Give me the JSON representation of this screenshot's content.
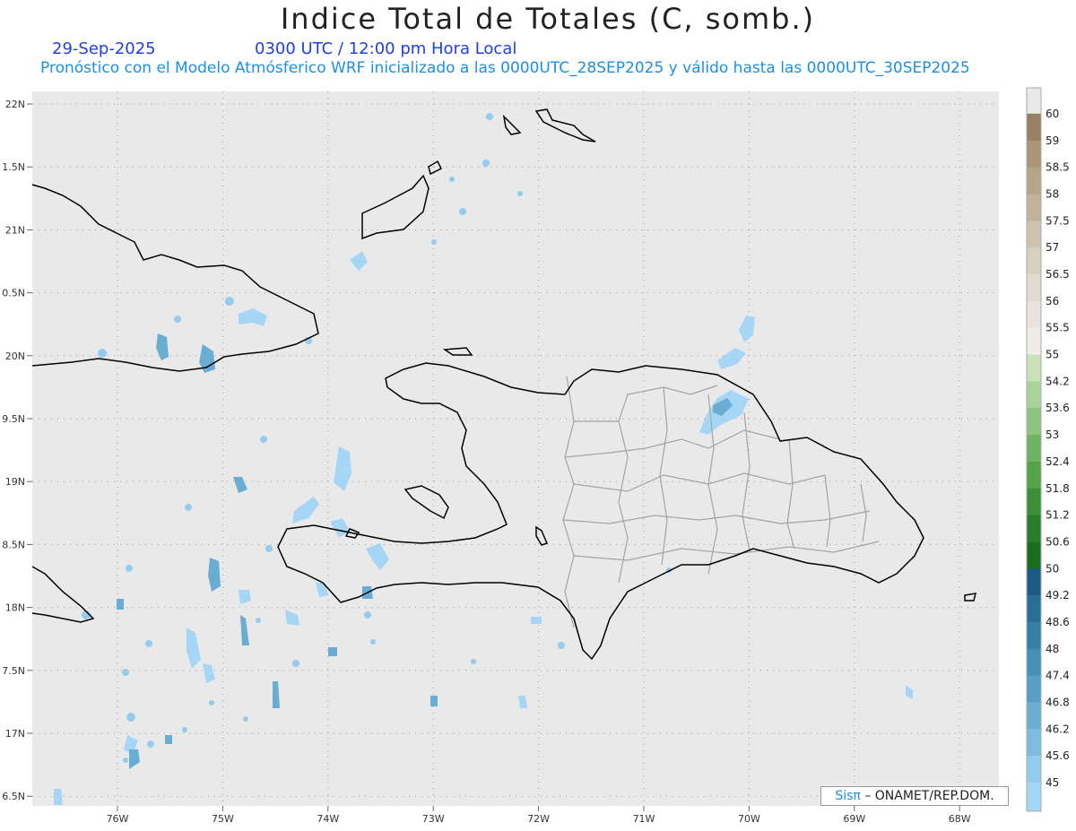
{
  "header": {
    "title": "Indice Total de Totales (C, somb.)",
    "date": "29-Sep-2025",
    "time": "0300 UTC / 12:00 pm Hora Local",
    "subtitle": "Pronóstico con el Modelo Atmósferico WRF inicializado a las 0000UTC_28SEP2025 y válido hasta las  0000UTC_30SEP2025"
  },
  "map": {
    "lat_labels": [
      "22N",
      "1.5N",
      "21N",
      "0.5N",
      "20N",
      "9.5N",
      "19N",
      "8.5N",
      "18N",
      "7.5N",
      "17N",
      "6.5N"
    ],
    "lon_labels": [
      "76W",
      "75W",
      "74W",
      "73W",
      "72W",
      "71W",
      "70W",
      "69W",
      "68W"
    ],
    "background_color": "#e9e9e9",
    "coast_color": "#000000",
    "province_color": "#a0a0a0"
  },
  "colorbar": {
    "labels": [
      "60",
      "59",
      "58.5",
      "58",
      "57.5",
      "57",
      "56.5",
      "56",
      "55.5",
      "55",
      "54.2",
      "53.6",
      "53",
      "52.4",
      "51.8",
      "51.2",
      "50.6",
      "50",
      "49.2",
      "48.6",
      "48",
      "47.4",
      "46.8",
      "46.2",
      "45.6",
      "45"
    ],
    "colors": [
      "#968262",
      "#a99776",
      "#b4a586",
      "#c1b39b",
      "#cdc2ae",
      "#d7cfbf",
      "#e0dbd0",
      "#e8e4dc",
      "#f0ede6",
      "#c6e3b8",
      "#a8d39b",
      "#8cc47f",
      "#6eb362",
      "#55a24a",
      "#3c8f37",
      "#2a7d2a",
      "#1a6d1c",
      "#1c5b86",
      "#276f99",
      "#3580a9",
      "#4690b8",
      "#589fc5",
      "#6aadd2",
      "#7dbcdf",
      "#93ccec"
    ],
    "top_color": "#e9e9e9",
    "bottom_color": "#a6d6f5"
  },
  "credit": {
    "brand": "Sisπ",
    "org": "– ONAMET/REP.DOM."
  }
}
